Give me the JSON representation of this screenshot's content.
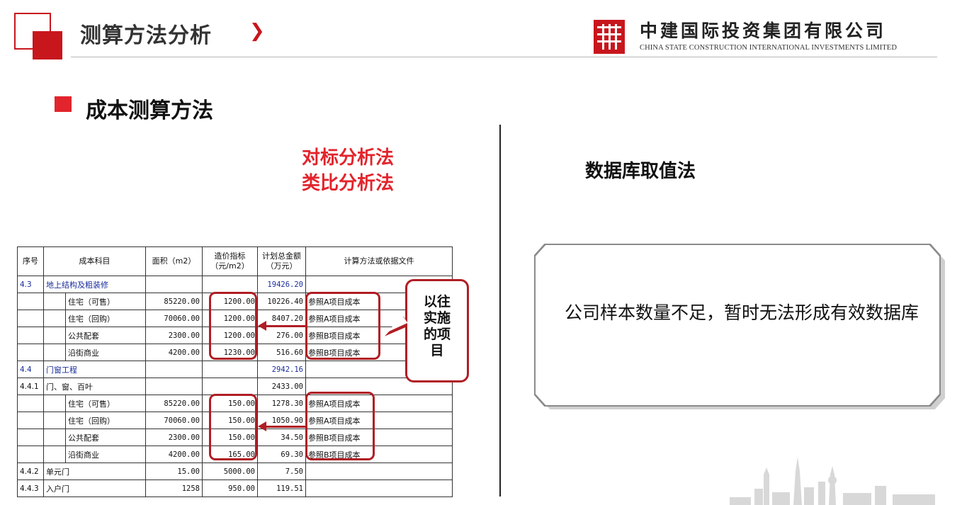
{
  "header": {
    "title": "测算方法分析",
    "chevron": "›",
    "company_cn": "中建国际投资集团有限公司",
    "company_en": "CHINA STATE CONSTRUCTION INTERNATIONAL INVESTMENTS LIMITED",
    "accent_color": "#c8161d"
  },
  "section": {
    "title": "成本测算方法"
  },
  "left": {
    "method_line1": "对标分析法",
    "method_line2": "类比分析法",
    "callout": "以往实施的项目"
  },
  "right": {
    "title": "数据库取值法",
    "box_text": "公司样本数量不足，暂时无法形成有效数据库"
  },
  "table": {
    "headers": [
      "序号",
      "成本科目",
      "面积（m2）",
      "造价指标（元/m2）",
      "计划总金额（万元）",
      "计算方法或依据文件"
    ],
    "rows": [
      [
        "4.3",
        "地上结构及粗装修",
        "",
        "",
        "",
        "19426.20",
        ""
      ],
      [
        "",
        "",
        "住宅（可售）",
        "85220.00",
        "1200.00",
        "10226.40",
        "参照A项目成本"
      ],
      [
        "",
        "",
        "住宅（回购）",
        "70060.00",
        "1200.00",
        "8407.20",
        "参照A项目成本"
      ],
      [
        "",
        "",
        "公共配套",
        "2300.00",
        "1200.00",
        "276.00",
        "参照B项目成本"
      ],
      [
        "",
        "",
        "沿街商业",
        "4200.00",
        "1230.00",
        "516.60",
        "参照B项目成本"
      ],
      [
        "4.4",
        "门窗工程",
        "",
        "",
        "",
        "2942.16",
        ""
      ],
      [
        "4.4.1",
        "门、窗、百叶",
        "",
        "",
        "",
        "2433.00",
        ""
      ],
      [
        "",
        "",
        "住宅（可售）",
        "85220.00",
        "150.00",
        "1278.30",
        "参照A项目成本"
      ],
      [
        "",
        "",
        "住宅（回购）",
        "70060.00",
        "150.00",
        "1050.90",
        "参照A项目成本"
      ],
      [
        "",
        "",
        "公共配套",
        "2300.00",
        "150.00",
        "34.50",
        "参照B项目成本"
      ],
      [
        "",
        "",
        "沿街商业",
        "4200.00",
        "165.00",
        "69.30",
        "参照B项目成本"
      ],
      [
        "4.4.2",
        "单元门",
        "",
        "15.00",
        "5000.00",
        "7.50",
        ""
      ],
      [
        "4.4.3",
        "入户门",
        "",
        "1258",
        "950.00",
        "119.51",
        ""
      ]
    ]
  }
}
